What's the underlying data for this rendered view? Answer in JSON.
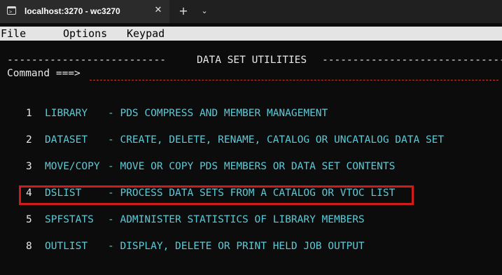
{
  "window": {
    "tab_title": "localhost:3270 - wc3270",
    "close_glyph": "✕",
    "new_tab_glyph": "+",
    "dropdown_glyph": "⌄",
    "terminal_icon_glyph": ">_"
  },
  "menu": {
    "items": [
      "File",
      "Options",
      "Keypad"
    ]
  },
  "screen": {
    "header_left": "--------------------------",
    "header_title": "DATA SET UTILITIES",
    "header_right": "-------------------------------",
    "command_label": "Command ===>",
    "command_value": "",
    "options": [
      {
        "num": "1",
        "name": "LIBRARY",
        "desc": "- PDS COMPRESS AND MEMBER MANAGEMENT"
      },
      {
        "num": "2",
        "name": "DATASET",
        "desc": "- CREATE, DELETE, RENAME, CATALOG OR UNCATALOG DATA SET"
      },
      {
        "num": "3",
        "name": "MOVE/COPY",
        "desc": "- MOVE OR COPY PDS MEMBERS OR DATA SET CONTENTS"
      },
      {
        "num": "4",
        "name": "DSLIST",
        "desc": "- PROCESS DATA SETS FROM A CATALOG OR VTOC LIST"
      },
      {
        "num": "5",
        "name": "SPFSTATS",
        "desc": "- ADMINISTER STATISTICS OF LIBRARY MEMBERS"
      },
      {
        "num": "8",
        "name": "OUTLIST",
        "desc": "- DISPLAY, DELETE OR PRINT HELD JOB OUTPUT"
      }
    ],
    "highlighted_option": "4"
  },
  "colors": {
    "terminal_bg": "#0c0c0c",
    "text_white": "#e8e8e8",
    "text_cyan": "#5fc9d6",
    "text_red": "#e74856",
    "highlight_border": "#d11a1a"
  }
}
